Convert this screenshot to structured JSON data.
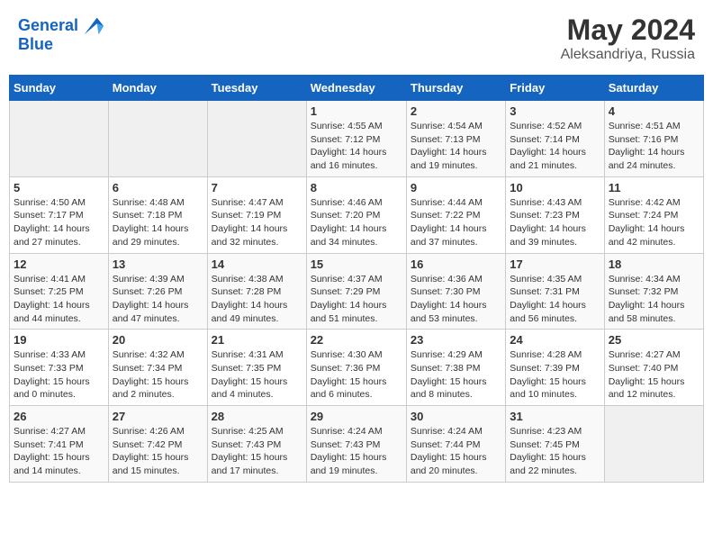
{
  "header": {
    "logo_line1": "General",
    "logo_line2": "Blue",
    "month": "May 2024",
    "location": "Aleksandriya, Russia"
  },
  "days_of_week": [
    "Sunday",
    "Monday",
    "Tuesday",
    "Wednesday",
    "Thursday",
    "Friday",
    "Saturday"
  ],
  "weeks": [
    [
      {
        "day": "",
        "info": ""
      },
      {
        "day": "",
        "info": ""
      },
      {
        "day": "",
        "info": ""
      },
      {
        "day": "1",
        "info": "Sunrise: 4:55 AM\nSunset: 7:12 PM\nDaylight: 14 hours and 16 minutes."
      },
      {
        "day": "2",
        "info": "Sunrise: 4:54 AM\nSunset: 7:13 PM\nDaylight: 14 hours and 19 minutes."
      },
      {
        "day": "3",
        "info": "Sunrise: 4:52 AM\nSunset: 7:14 PM\nDaylight: 14 hours and 21 minutes."
      },
      {
        "day": "4",
        "info": "Sunrise: 4:51 AM\nSunset: 7:16 PM\nDaylight: 14 hours and 24 minutes."
      }
    ],
    [
      {
        "day": "5",
        "info": "Sunrise: 4:50 AM\nSunset: 7:17 PM\nDaylight: 14 hours and 27 minutes."
      },
      {
        "day": "6",
        "info": "Sunrise: 4:48 AM\nSunset: 7:18 PM\nDaylight: 14 hours and 29 minutes."
      },
      {
        "day": "7",
        "info": "Sunrise: 4:47 AM\nSunset: 7:19 PM\nDaylight: 14 hours and 32 minutes."
      },
      {
        "day": "8",
        "info": "Sunrise: 4:46 AM\nSunset: 7:20 PM\nDaylight: 14 hours and 34 minutes."
      },
      {
        "day": "9",
        "info": "Sunrise: 4:44 AM\nSunset: 7:22 PM\nDaylight: 14 hours and 37 minutes."
      },
      {
        "day": "10",
        "info": "Sunrise: 4:43 AM\nSunset: 7:23 PM\nDaylight: 14 hours and 39 minutes."
      },
      {
        "day": "11",
        "info": "Sunrise: 4:42 AM\nSunset: 7:24 PM\nDaylight: 14 hours and 42 minutes."
      }
    ],
    [
      {
        "day": "12",
        "info": "Sunrise: 4:41 AM\nSunset: 7:25 PM\nDaylight: 14 hours and 44 minutes."
      },
      {
        "day": "13",
        "info": "Sunrise: 4:39 AM\nSunset: 7:26 PM\nDaylight: 14 hours and 47 minutes."
      },
      {
        "day": "14",
        "info": "Sunrise: 4:38 AM\nSunset: 7:28 PM\nDaylight: 14 hours and 49 minutes."
      },
      {
        "day": "15",
        "info": "Sunrise: 4:37 AM\nSunset: 7:29 PM\nDaylight: 14 hours and 51 minutes."
      },
      {
        "day": "16",
        "info": "Sunrise: 4:36 AM\nSunset: 7:30 PM\nDaylight: 14 hours and 53 minutes."
      },
      {
        "day": "17",
        "info": "Sunrise: 4:35 AM\nSunset: 7:31 PM\nDaylight: 14 hours and 56 minutes."
      },
      {
        "day": "18",
        "info": "Sunrise: 4:34 AM\nSunset: 7:32 PM\nDaylight: 14 hours and 58 minutes."
      }
    ],
    [
      {
        "day": "19",
        "info": "Sunrise: 4:33 AM\nSunset: 7:33 PM\nDaylight: 15 hours and 0 minutes."
      },
      {
        "day": "20",
        "info": "Sunrise: 4:32 AM\nSunset: 7:34 PM\nDaylight: 15 hours and 2 minutes."
      },
      {
        "day": "21",
        "info": "Sunrise: 4:31 AM\nSunset: 7:35 PM\nDaylight: 15 hours and 4 minutes."
      },
      {
        "day": "22",
        "info": "Sunrise: 4:30 AM\nSunset: 7:36 PM\nDaylight: 15 hours and 6 minutes."
      },
      {
        "day": "23",
        "info": "Sunrise: 4:29 AM\nSunset: 7:38 PM\nDaylight: 15 hours and 8 minutes."
      },
      {
        "day": "24",
        "info": "Sunrise: 4:28 AM\nSunset: 7:39 PM\nDaylight: 15 hours and 10 minutes."
      },
      {
        "day": "25",
        "info": "Sunrise: 4:27 AM\nSunset: 7:40 PM\nDaylight: 15 hours and 12 minutes."
      }
    ],
    [
      {
        "day": "26",
        "info": "Sunrise: 4:27 AM\nSunset: 7:41 PM\nDaylight: 15 hours and 14 minutes."
      },
      {
        "day": "27",
        "info": "Sunrise: 4:26 AM\nSunset: 7:42 PM\nDaylight: 15 hours and 15 minutes."
      },
      {
        "day": "28",
        "info": "Sunrise: 4:25 AM\nSunset: 7:43 PM\nDaylight: 15 hours and 17 minutes."
      },
      {
        "day": "29",
        "info": "Sunrise: 4:24 AM\nSunset: 7:43 PM\nDaylight: 15 hours and 19 minutes."
      },
      {
        "day": "30",
        "info": "Sunrise: 4:24 AM\nSunset: 7:44 PM\nDaylight: 15 hours and 20 minutes."
      },
      {
        "day": "31",
        "info": "Sunrise: 4:23 AM\nSunset: 7:45 PM\nDaylight: 15 hours and 22 minutes."
      },
      {
        "day": "",
        "info": ""
      }
    ]
  ]
}
